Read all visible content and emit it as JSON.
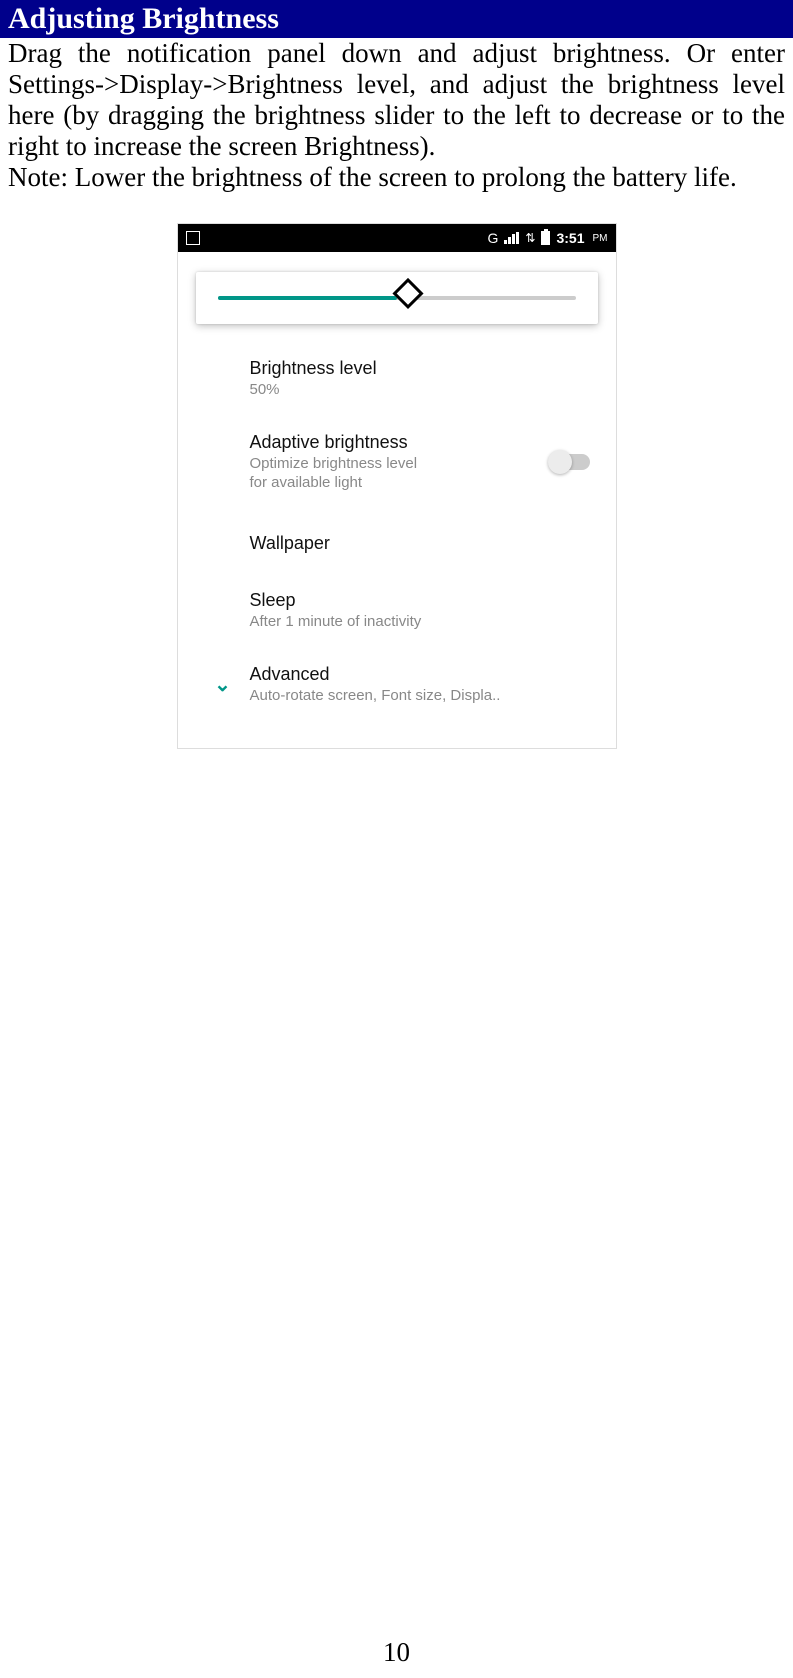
{
  "header": {
    "title": "Adjusting Brightness"
  },
  "body": {
    "paragraph1": "Drag the notification panel down and adjust brightness. Or enter Settings->Display->Brightness level, and adjust the brightness level here (by dragging the brightness slider to the left to decrease or to the right to increase the screen Brightness).",
    "paragraph2": "Note: Lower the brightness of the screen to prolong the battery life."
  },
  "phone": {
    "status": {
      "network_label": "G",
      "time": "3:51",
      "ampm": "PM"
    },
    "slider": {
      "percent": 50
    },
    "settings": {
      "brightness": {
        "title": "Brightness level",
        "sub": "50%"
      },
      "adaptive": {
        "title": "Adaptive brightness",
        "sub1": "Optimize brightness level",
        "sub2": "for available light",
        "toggled": false
      },
      "wallpaper": {
        "title": "Wallpaper"
      },
      "sleep": {
        "title": "Sleep",
        "sub": "After 1 minute of inactivity"
      },
      "advanced": {
        "title": "Advanced",
        "sub": "Auto-rotate screen, Font size, Displa.."
      }
    }
  },
  "page_number": "10"
}
